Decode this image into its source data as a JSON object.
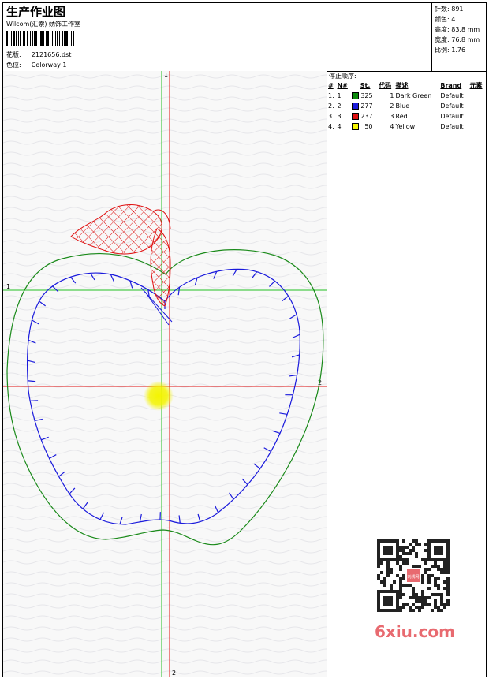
{
  "header": {
    "title": "生产作业图",
    "studio": "Wilcom(汇索) 绣饰工作室",
    "design_label": "花版:",
    "design_value": "2121656.dst",
    "colorway_label": "色位:",
    "colorway_value": "Colorway 1"
  },
  "stats": {
    "stitches": "针数: 891",
    "colors": "颜色: 4",
    "height": "高度: 83.8 mm",
    "width": "宽度: 76.8 mm",
    "scale": "比例: 1.76"
  },
  "stop_sequence": {
    "title": "停止顺序:",
    "columns": [
      "#",
      "N#",
      "St.",
      "代码",
      "描述",
      "Brand",
      "元素"
    ],
    "rows": [
      {
        "num": "1.",
        "n": "1",
        "color": "#0a8a0a",
        "st": "325",
        "code": "1",
        "desc": "Dark Green",
        "brand": "Default"
      },
      {
        "num": "2.",
        "n": "2",
        "color": "#1a1adc",
        "st": "277",
        "code": "2",
        "desc": "Blue",
        "brand": "Default"
      },
      {
        "num": "3.",
        "n": "3",
        "color": "#e01010",
        "st": "237",
        "code": "3",
        "desc": "Red",
        "brand": "Default"
      },
      {
        "num": "4.",
        "n": "4",
        "color": "#f4f400",
        "st": "50",
        "code": "4",
        "desc": "Yellow",
        "brand": "Default"
      }
    ]
  },
  "axes": {
    "v_top": "1",
    "h_left": "1",
    "h_right": "2",
    "v_bottom": "2"
  },
  "watermark": "6xiu.com",
  "qr_center": "刺绣网",
  "colors": {
    "green_axis": "#22c022",
    "red_axis": "#e01010",
    "outline_green": "#1a8a1a",
    "satin_blue": "#1a1adc",
    "leaf_red": "#e01010",
    "center_yellow": "#f4f400",
    "watermark": "#e86a70"
  }
}
